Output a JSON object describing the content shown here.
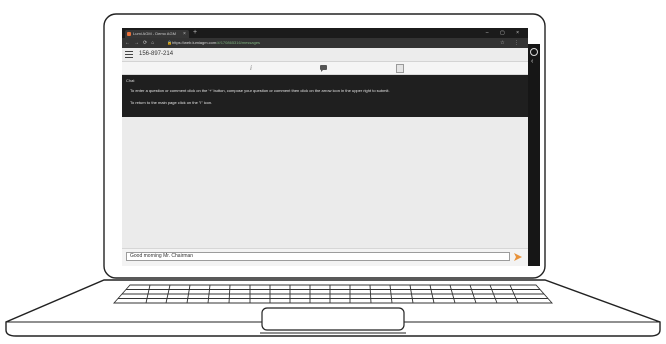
{
  "browser": {
    "tab_title": "Lumi AGM - Demo AGM",
    "tab_close": "×",
    "new_tab": "+",
    "window_controls": "–  ▢  ×",
    "nav_icons": "←→⟳⌂",
    "url_host": "https://web.lumiagm.com",
    "url_path": "/#/170865316/messages",
    "address_right_icons": "☆ ⋮"
  },
  "app": {
    "meeting_id": "156-897-214"
  },
  "toolbar": {
    "info_icon_glyph": "i"
  },
  "chat": {
    "title": "Chat",
    "instruction_1": "To enter a question or comment click on the '+' button, compose your question or comment then click on the arrow icon in the upper right to submit.",
    "instruction_2": "To return to the main page click on the \"i\" icon."
  },
  "input": {
    "value": "Good morning Mr. Chairman"
  },
  "side": {
    "back_glyph": "‹"
  },
  "colors": {
    "accent_orange": "#e8703a",
    "chat_bg": "#1f1f1f",
    "browser_chrome": "#2a2a2a"
  },
  "icons": [
    "hamburger-menu-icon",
    "info-icon",
    "chat-bubble-icon",
    "document-icon",
    "send-arrow-icon",
    "settings-icon",
    "chevron-left-icon"
  ]
}
